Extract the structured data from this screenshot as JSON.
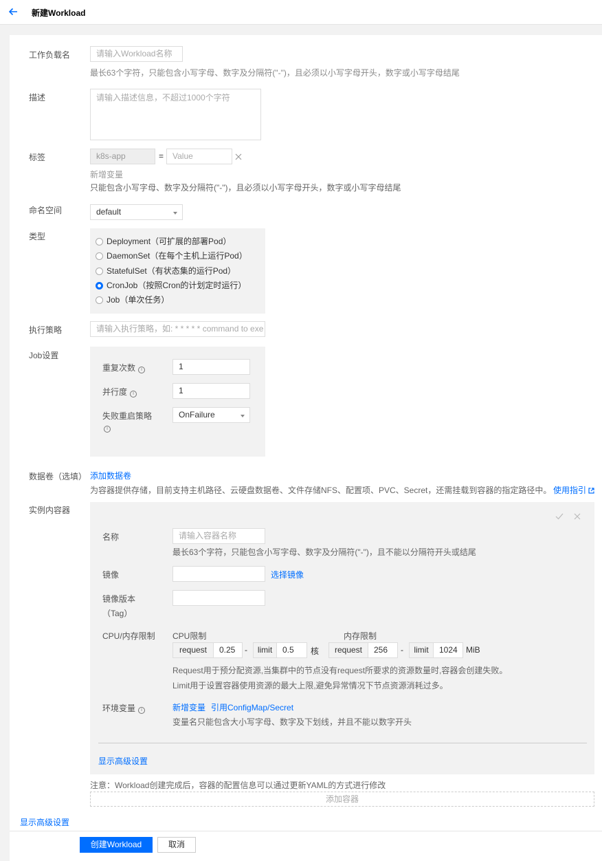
{
  "header": {
    "title": "新建Workload"
  },
  "workload_name": {
    "label": "工作负载名",
    "placeholder": "请输入Workload名称",
    "hint": "最长63个字符，只能包含小写字母、数字及分隔符(\"-\")，且必须以小写字母开头，数字或小写字母结尾"
  },
  "description": {
    "label": "描述",
    "placeholder": "请输入描述信息，不超过1000个字符"
  },
  "labels": {
    "label": "标签",
    "key_value": "k8s-app",
    "equals": "=",
    "value_placeholder": "Value",
    "add_label": "新增变量",
    "hint": "只能包含小写字母、数字及分隔符(\"-\")，且必须以小写字母开头，数字或小写字母结尾"
  },
  "namespace": {
    "label": "命名空间",
    "value": "default"
  },
  "type": {
    "label": "类型",
    "options": [
      "Deployment（可扩展的部署Pod）",
      "DaemonSet（在每个主机上运行Pod）",
      "StatefulSet（有状态集的运行Pod）",
      "CronJob（按照Cron的计划定时运行）",
      "Job（单次任务）"
    ],
    "selected": "CronJob（按照Cron的计划定时运行）"
  },
  "policy": {
    "label": "执行策略",
    "placeholder": "请输入执行策略，如: * * * * * command to exe"
  },
  "job": {
    "label": "Job设置",
    "repeat_label": "重复次数",
    "repeat_value": "1",
    "parallel_label": "并行度",
    "parallel_value": "1",
    "restart_label": "失败重启策略",
    "restart_value": "OnFailure"
  },
  "volumes": {
    "label": "数据卷（选填）",
    "add_link": "添加数据卷",
    "hint": "为容器提供存储，目前支持主机路径、云硬盘数据卷、文件存储NFS、配置项、PVC、Secret，还需挂载到容器的指定路径中。",
    "guide_link": "使用指引"
  },
  "containers": {
    "label": "实例内容器",
    "name_label": "名称",
    "name_placeholder": "请输入容器名称",
    "name_hint": "最长63个字符，只能包含小写字母、数字及分隔符(\"-\")，且不能以分隔符开头或结尾",
    "image_label": "镜像",
    "image_link": "选择镜像",
    "tag_label": "镜像版本",
    "tag_label2": "（Tag）",
    "limits_label": "CPU/内存限制",
    "cpu_label": "CPU限制",
    "mem_label": "内存限制",
    "request_text": "request",
    "limit_text": "limit",
    "dash": "-",
    "cpu_request": "0.25",
    "cpu_limit": "0.5",
    "cpu_unit": "核",
    "mem_request": "256",
    "mem_limit": "1024",
    "mem_unit": "MiB",
    "limits_hint1": "Request用于预分配资源,当集群中的节点没有request所要求的资源数量时,容器会创建失败。",
    "limits_hint2": "Limit用于设置容器使用资源的最大上限,避免异常情况下节点资源消耗过多。",
    "env_label": "环境变量",
    "env_add_link": "新增变量",
    "env_ref_link": "引用ConfigMap/Secret",
    "env_hint": "变量名只能包含大小写字母、数字及下划线，并且不能以数字开头",
    "advanced_link": "显示高级设置",
    "note": "注意：Workload创建完成后，容器的配置信息可以通过更新YAML的方式进行修改",
    "add_container": "添加容器"
  },
  "advanced_link": "显示高级设置",
  "footer": {
    "create": "创建Workload",
    "cancel": "取消"
  },
  "colors": {
    "accent": "#006eff",
    "panel": "#f2f2f2"
  }
}
